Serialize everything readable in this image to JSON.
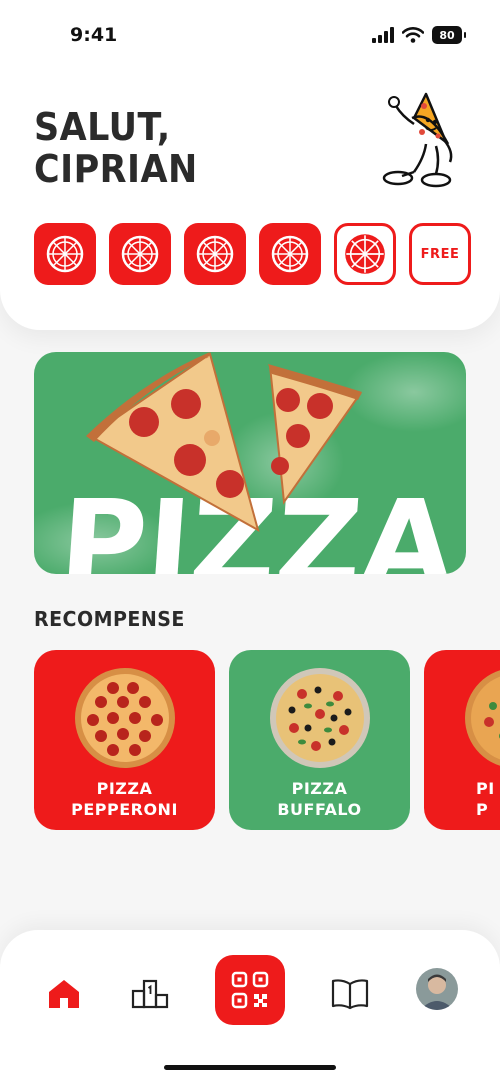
{
  "status_bar": {
    "time": "9:41",
    "battery": "80"
  },
  "greeting": {
    "line1": "SALUT,",
    "line2": "CIPRIAN"
  },
  "loyalty": {
    "stamps": [
      {
        "state": "earned"
      },
      {
        "state": "earned"
      },
      {
        "state": "earned"
      },
      {
        "state": "earned"
      },
      {
        "state": "next"
      }
    ],
    "free_label": "FREE"
  },
  "promo": {
    "word": "PIZZA"
  },
  "rewards": {
    "title": "RECOMPENSE",
    "items": [
      {
        "line1": "PIZZA",
        "line2": "PEPPERONI",
        "color": "#ee1b1b"
      },
      {
        "line1": "PIZZA",
        "line2": "BUFFALO",
        "color": "#4bab6b"
      },
      {
        "line1": "PI",
        "line2": "P",
        "color": "#ee1b1b"
      }
    ]
  },
  "colors": {
    "brand_red": "#ee1b1b",
    "brand_green": "#4bab6b",
    "text_dark": "#2b2b2b"
  },
  "tabbar": {
    "items": [
      {
        "name": "home",
        "icon": "home-icon",
        "active": true
      },
      {
        "name": "rankings",
        "icon": "podium-icon"
      },
      {
        "name": "scan",
        "icon": "qr-code-icon"
      },
      {
        "name": "menu",
        "icon": "book-icon"
      },
      {
        "name": "profile",
        "icon": "avatar"
      }
    ]
  }
}
